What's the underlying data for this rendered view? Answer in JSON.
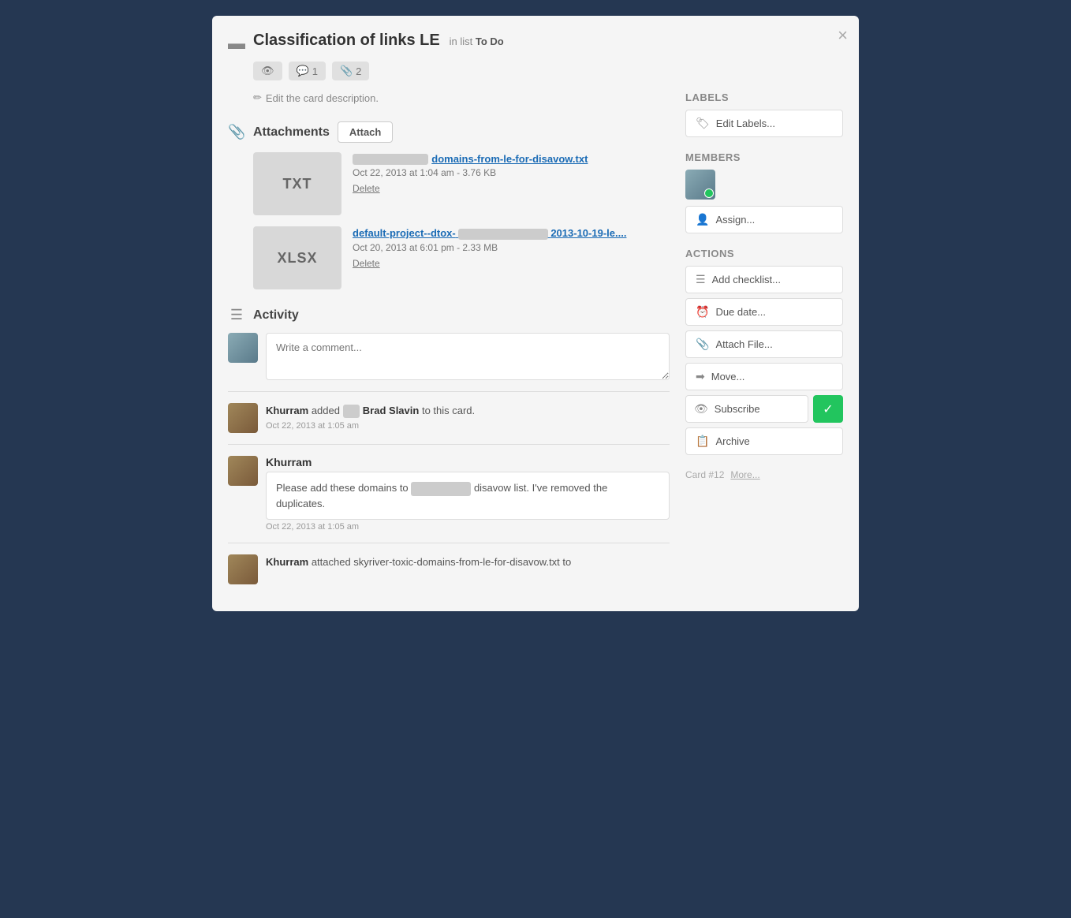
{
  "modal": {
    "title": "Classification of links LE",
    "in_list_label": "in list",
    "list_name": "To Do",
    "close_label": "×",
    "meta_badges": [
      {
        "icon": "👁",
        "label": ""
      },
      {
        "icon": "💬",
        "count": "1"
      },
      {
        "icon": "📎",
        "count": "2"
      }
    ],
    "description": {
      "edit_link_label": "Edit the card description."
    }
  },
  "attachments": {
    "section_title": "Attachments",
    "attach_btn_label": "Attach",
    "items": [
      {
        "thumb_label": "TXT",
        "name": "domains-from-le-for-disavow.txt",
        "meta": "Oct 22, 2013 at 1:04 am - 3.76 KB",
        "delete_label": "Delete"
      },
      {
        "thumb_label": "XLSX",
        "name": "default-project--dtox-  2013-10-19-le....",
        "meta": "Oct 20, 2013 at 6:01 pm - 2.33 MB",
        "delete_label": "Delete"
      }
    ]
  },
  "activity": {
    "section_title": "Activity",
    "comment_placeholder": "Write a comment...",
    "entries": [
      {
        "type": "action",
        "user": "Khurram",
        "action_text": "added",
        "target": "Brad Slavin",
        "action_suffix": "to this card.",
        "timestamp": "Oct 22, 2013 at 1:05 am"
      },
      {
        "type": "comment",
        "user": "Khurram",
        "comment": "Please add these domains to  disavow list. I've removed the duplicates.",
        "timestamp": "Oct 22, 2013 at 1:05 am"
      },
      {
        "type": "action",
        "user": "Khurram",
        "action_text": "attached skyriver-toxic-domains-from-le-for-disavow.txt to",
        "timestamp": ""
      }
    ]
  },
  "sidebar": {
    "labels": {
      "section_title": "Labels",
      "edit_btn_label": "Edit Labels..."
    },
    "members": {
      "section_title": "Members",
      "assign_btn_label": "Assign..."
    },
    "actions": {
      "section_title": "Actions",
      "buttons": [
        {
          "icon": "☰",
          "label": "Add checklist..."
        },
        {
          "icon": "⏰",
          "label": "Due date..."
        },
        {
          "icon": "📎",
          "label": "Attach File..."
        },
        {
          "icon": "➡",
          "label": "Move..."
        }
      ],
      "subscribe_label": "Subscribe",
      "archive_label": "Archive"
    },
    "footer": {
      "card_number": "Card #12",
      "more_label": "More..."
    }
  }
}
